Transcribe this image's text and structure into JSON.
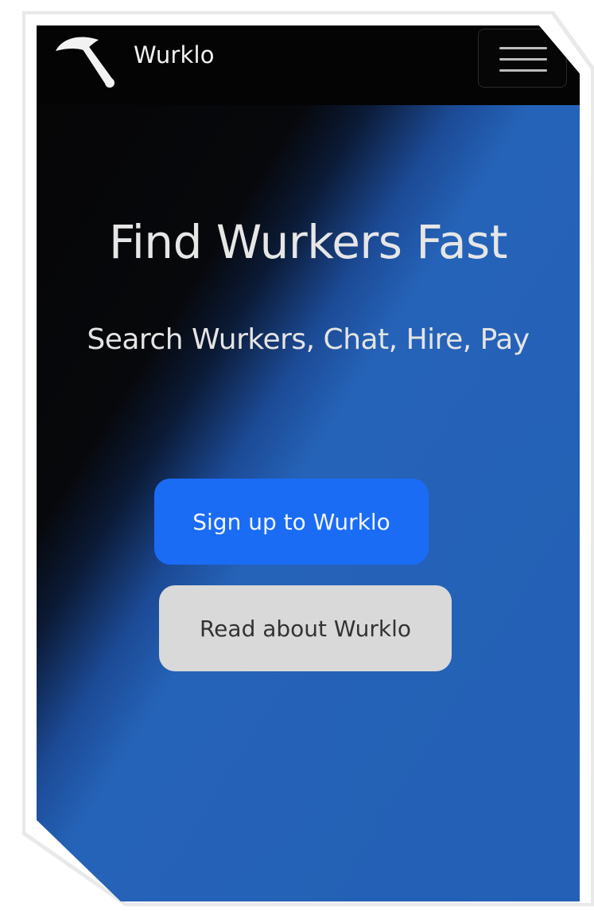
{
  "navbar": {
    "brand": "Wurklo",
    "logo_icon": "pickaxe-icon",
    "menu_icon": "hamburger-menu-icon"
  },
  "hero": {
    "title": "Find Wurkers Fast",
    "subtitle": "Search Wurkers, Chat, Hire, Pay"
  },
  "actions": {
    "signup_label": "Sign up to Wurklo",
    "read_label": "Read about Wurklo"
  },
  "colors": {
    "navbar_bg": "#040404",
    "hero_blue": "#2563b8",
    "primary_button": "#1a6cf5",
    "secondary_button": "#d9d9d9"
  }
}
